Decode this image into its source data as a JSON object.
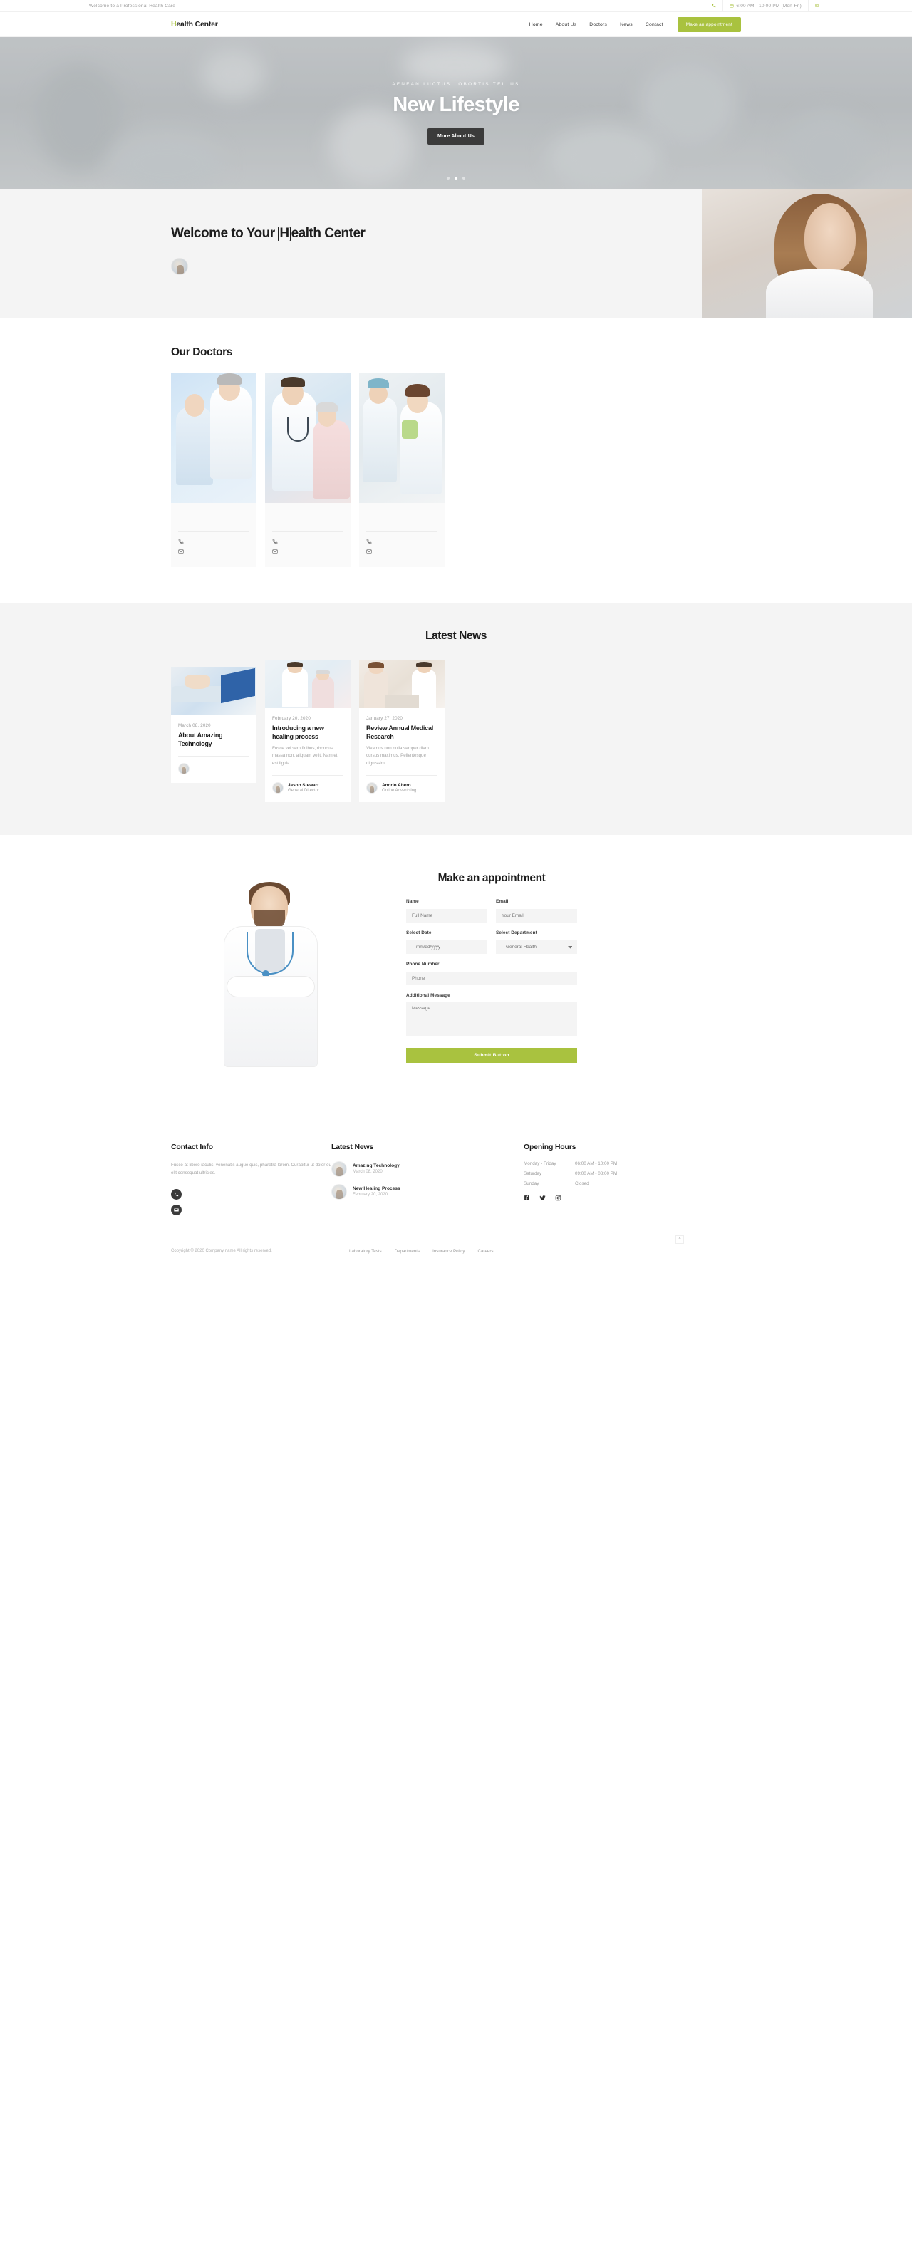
{
  "topbar": {
    "welcome_text": "Welcome to a Professional Health Care",
    "phone_icon": "phone-icon",
    "hours_icon": "calendar-icon",
    "hours_text": "6:00 AM - 10:00 PM (Mon-Fri)",
    "mail_icon": "mail-icon"
  },
  "nav": {
    "logo_mark": "H",
    "logo_text": "ealth Center",
    "links": [
      {
        "label": "Home",
        "active": true
      },
      {
        "label": "About Us",
        "active": false
      },
      {
        "label": "Doctors",
        "active": false
      },
      {
        "label": "News",
        "active": false
      },
      {
        "label": "Contact",
        "active": false
      }
    ],
    "cta_label": "Make an appointment",
    "accent_color": "#a9c23f"
  },
  "hero": {
    "subtitle": "AENEAN LUCTUS LOBORTIS TELLUS",
    "title": "New Lifestyle",
    "button_label": "More About Us",
    "slides": 3,
    "active_slide": 1
  },
  "welcome": {
    "title_prefix": "Welcome to Your ",
    "title_mark": "H",
    "title_suffix": "ealth Center",
    "avatar": "doctor-avatar"
  },
  "doctors": {
    "title": "Our Doctors",
    "cards": [
      {
        "name": "",
        "role": "",
        "phone": "",
        "email": ""
      },
      {
        "name": "",
        "role": "",
        "phone": "",
        "email": ""
      },
      {
        "name": "",
        "role": "",
        "phone": "",
        "email": ""
      }
    ]
  },
  "news": {
    "title": "Latest News",
    "cards": [
      {
        "date": "March 08, 2020",
        "title": "About Amazing Technology",
        "excerpt": "",
        "author_name": "",
        "author_role": ""
      },
      {
        "date": "February 20, 2020",
        "title": "Introducing a new healing process",
        "excerpt": "Fusce vel sem finibus, rhoncus massa non, aliquam velit. Nam et est ligula.",
        "author_name": "Jason Stewart",
        "author_role": "General Director"
      },
      {
        "date": "January 27, 2020",
        "title": "Review Annual Medical Research",
        "excerpt": "Vivamus non nulla semper diam cursus maximus. Pellentesque dignissim.",
        "author_name": "Andrio Abero",
        "author_role": "Online Advertising"
      }
    ]
  },
  "appointment": {
    "title": "Make an appointment",
    "fields": {
      "name_label": "Name",
      "name_placeholder": "Full Name",
      "email_label": "Email",
      "email_placeholder": "Your Email",
      "date_label": "Select Date",
      "date_placeholder": "mm/dd/yyyy",
      "department_label": "Select Department",
      "department_value": "General Health",
      "phone_label": "Phone Number",
      "phone_placeholder": "Phone",
      "message_label": "Additional Message",
      "message_placeholder": "Message"
    },
    "submit_label": "Submit Button",
    "submit_color": "#a9c23f"
  },
  "footer": {
    "contact": {
      "title": "Contact Info",
      "text": "Fusce at libero iaculis, venenatis augue quis, pharetra lorem. Curabitur ut dolor eu elit consequat ultricies.",
      "phone_icon": "phone-icon",
      "mail_icon": "mail-icon"
    },
    "latest_news": {
      "title": "Latest News",
      "items": [
        {
          "title": "Amazing Technology",
          "date": "March 08, 2020"
        },
        {
          "title": "New Healing Process",
          "date": "February 20, 2020"
        }
      ]
    },
    "opening_hours": {
      "title": "Opening Hours",
      "rows": [
        {
          "day": "Monday - Friday",
          "time": "06:00 AM - 10:00 PM"
        },
        {
          "day": "Saturday",
          "time": "09:00 AM - 08:00 PM"
        },
        {
          "day": "Sunday",
          "time": "Closed"
        }
      ],
      "socials": [
        "facebook-icon",
        "twitter-icon",
        "instagram-icon"
      ]
    },
    "copyright": "Copyright © 2020 Company name All rights reserved.",
    "links": [
      "Laboratory Tests",
      "Departments",
      "Insurance Policy",
      "Careers"
    ],
    "back_to_top": "^"
  }
}
